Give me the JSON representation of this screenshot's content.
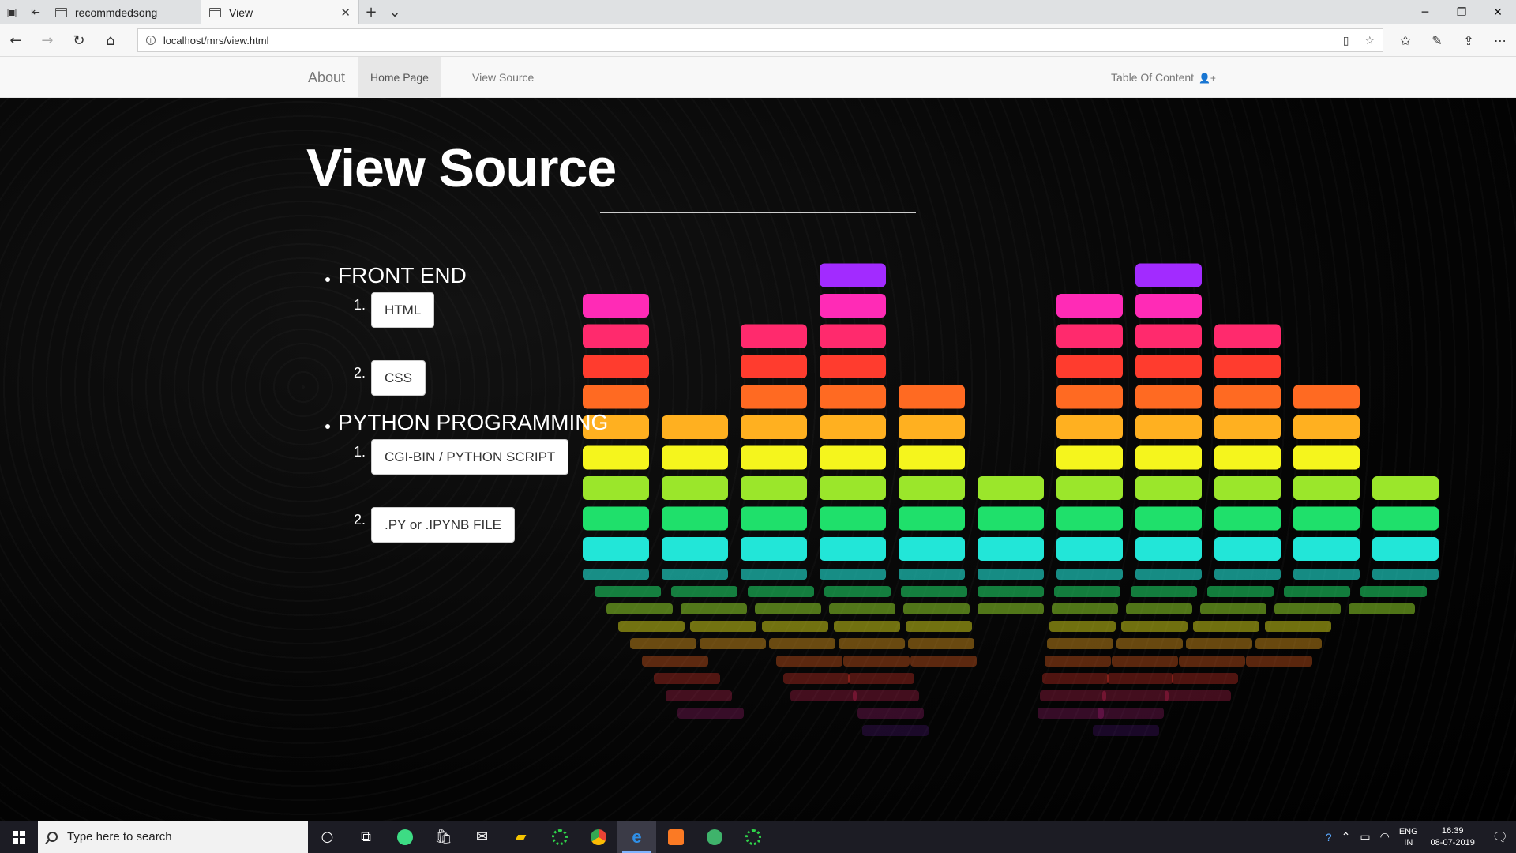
{
  "browser": {
    "tabs": [
      {
        "title": "recommdedsong",
        "active": false
      },
      {
        "title": "View",
        "active": true
      }
    ],
    "url": "localhost/mrs/view.html"
  },
  "site": {
    "brand": "About",
    "nav": [
      "Home Page",
      "View Source"
    ],
    "toc_label": "Table Of Content"
  },
  "main": {
    "title": "View Source",
    "sections": [
      {
        "heading": "FRONT END",
        "items": [
          {
            "num": "1.",
            "label": "HTML"
          },
          {
            "num": "2.",
            "label": "CSS"
          }
        ]
      },
      {
        "heading": "PYTHON PROGRAMMING",
        "items": [
          {
            "num": "1.",
            "label": "CGI-BIN / PYTHON SCRIPT"
          },
          {
            "num": "2.",
            "label": ".PY or .IPYNB FILE"
          }
        ]
      }
    ],
    "equalizer_levels": [
      9,
      5,
      8,
      10,
      6,
      3,
      9,
      10,
      8,
      6,
      3
    ],
    "equalizer_colors": [
      "#22e6d8",
      "#1fe06b",
      "#9be62b",
      "#f5f51d",
      "#ffb020",
      "#ff6a22",
      "#ff3c2e",
      "#ff2a6d",
      "#ff2bb6",
      "#a22bff"
    ]
  },
  "taskbar": {
    "search_placeholder": "Type here to search",
    "lang_top": "ENG",
    "lang_bottom": "IN",
    "time": "16:39",
    "date": "08-07-2019"
  }
}
